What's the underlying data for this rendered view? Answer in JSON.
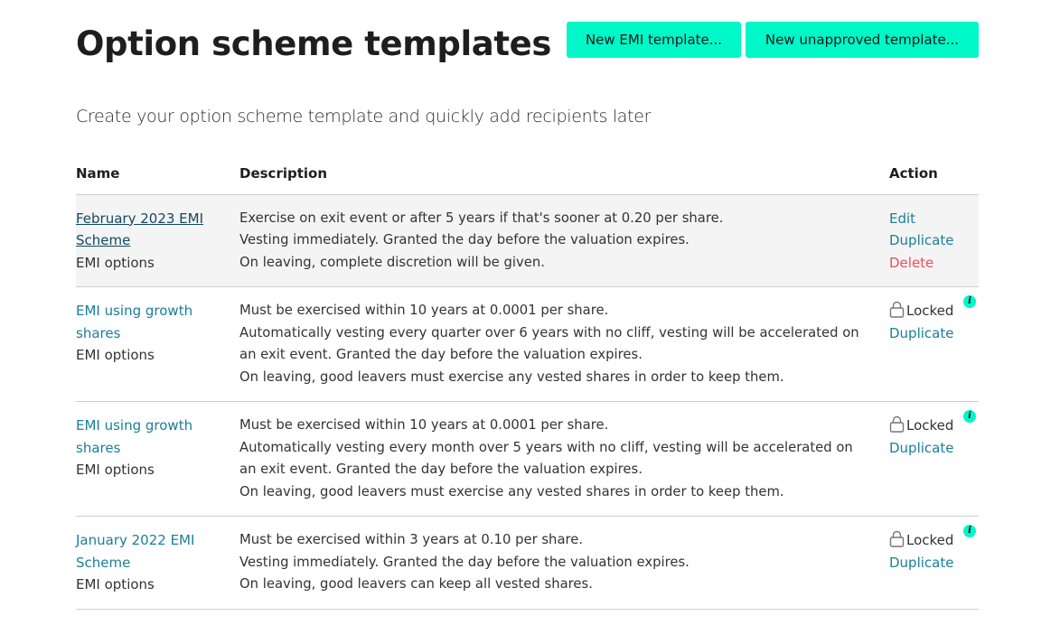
{
  "header": {
    "title": "Option scheme templates",
    "buttons": {
      "new_emi": "New EMI template...",
      "new_unapproved": "New unapproved template..."
    }
  },
  "subtitle": "Create your option scheme template and quickly add recipients later",
  "table": {
    "columns": {
      "name": "Name",
      "description": "Description",
      "action": "Action"
    },
    "rows": [
      {
        "name": "February 2023 EMI Scheme",
        "type": "EMI options",
        "description": [
          "Exercise on exit event or after 5 years if that's sooner at 0.20 per share.",
          "Vesting immediately. Granted the day before the valuation expires.",
          "On leaving, complete discretion will be given."
        ],
        "actions": {
          "edit": "Edit",
          "duplicate": "Duplicate",
          "delete": "Delete"
        }
      },
      {
        "name": "EMI using growth shares",
        "type": "EMI options",
        "description": [
          "Must be exercised within 10 years at 0.0001 per share.",
          "Automatically vesting every quarter over 6 years with no cliff, vesting will be accelerated on an exit event. Granted the day before the valuation expires.",
          "On leaving, good leavers must exercise any vested shares in order to keep them."
        ],
        "actions": {
          "locked": "Locked",
          "info": "i",
          "duplicate": "Duplicate"
        }
      },
      {
        "name": "EMI using growth shares",
        "type": "EMI options",
        "description": [
          "Must be exercised within 10 years at 0.0001 per share.",
          "Automatically vesting every month over 5 years with no cliff, vesting will be accelerated on an exit event. Granted the day before the valuation expires.",
          "On leaving, good leavers must exercise any vested shares in order to keep them."
        ],
        "actions": {
          "locked": "Locked",
          "info": "i",
          "duplicate": "Duplicate"
        }
      },
      {
        "name": "January 2022 EMI Scheme",
        "type": "EMI options",
        "description": [
          "Must be exercised within 3 years at 0.10 per share.",
          "Vesting immediately. Granted the day before the valuation expires.",
          "On leaving, good leavers can keep all vested shares."
        ],
        "actions": {
          "locked": "Locked",
          "info": "i",
          "duplicate": "Duplicate"
        }
      }
    ]
  },
  "colors": {
    "accent": "#00f7c7",
    "link": "#1a7f9a",
    "link_visited": "#13495f",
    "danger": "#ee4d5c",
    "selected_row_bg": "#f4f4f4"
  }
}
